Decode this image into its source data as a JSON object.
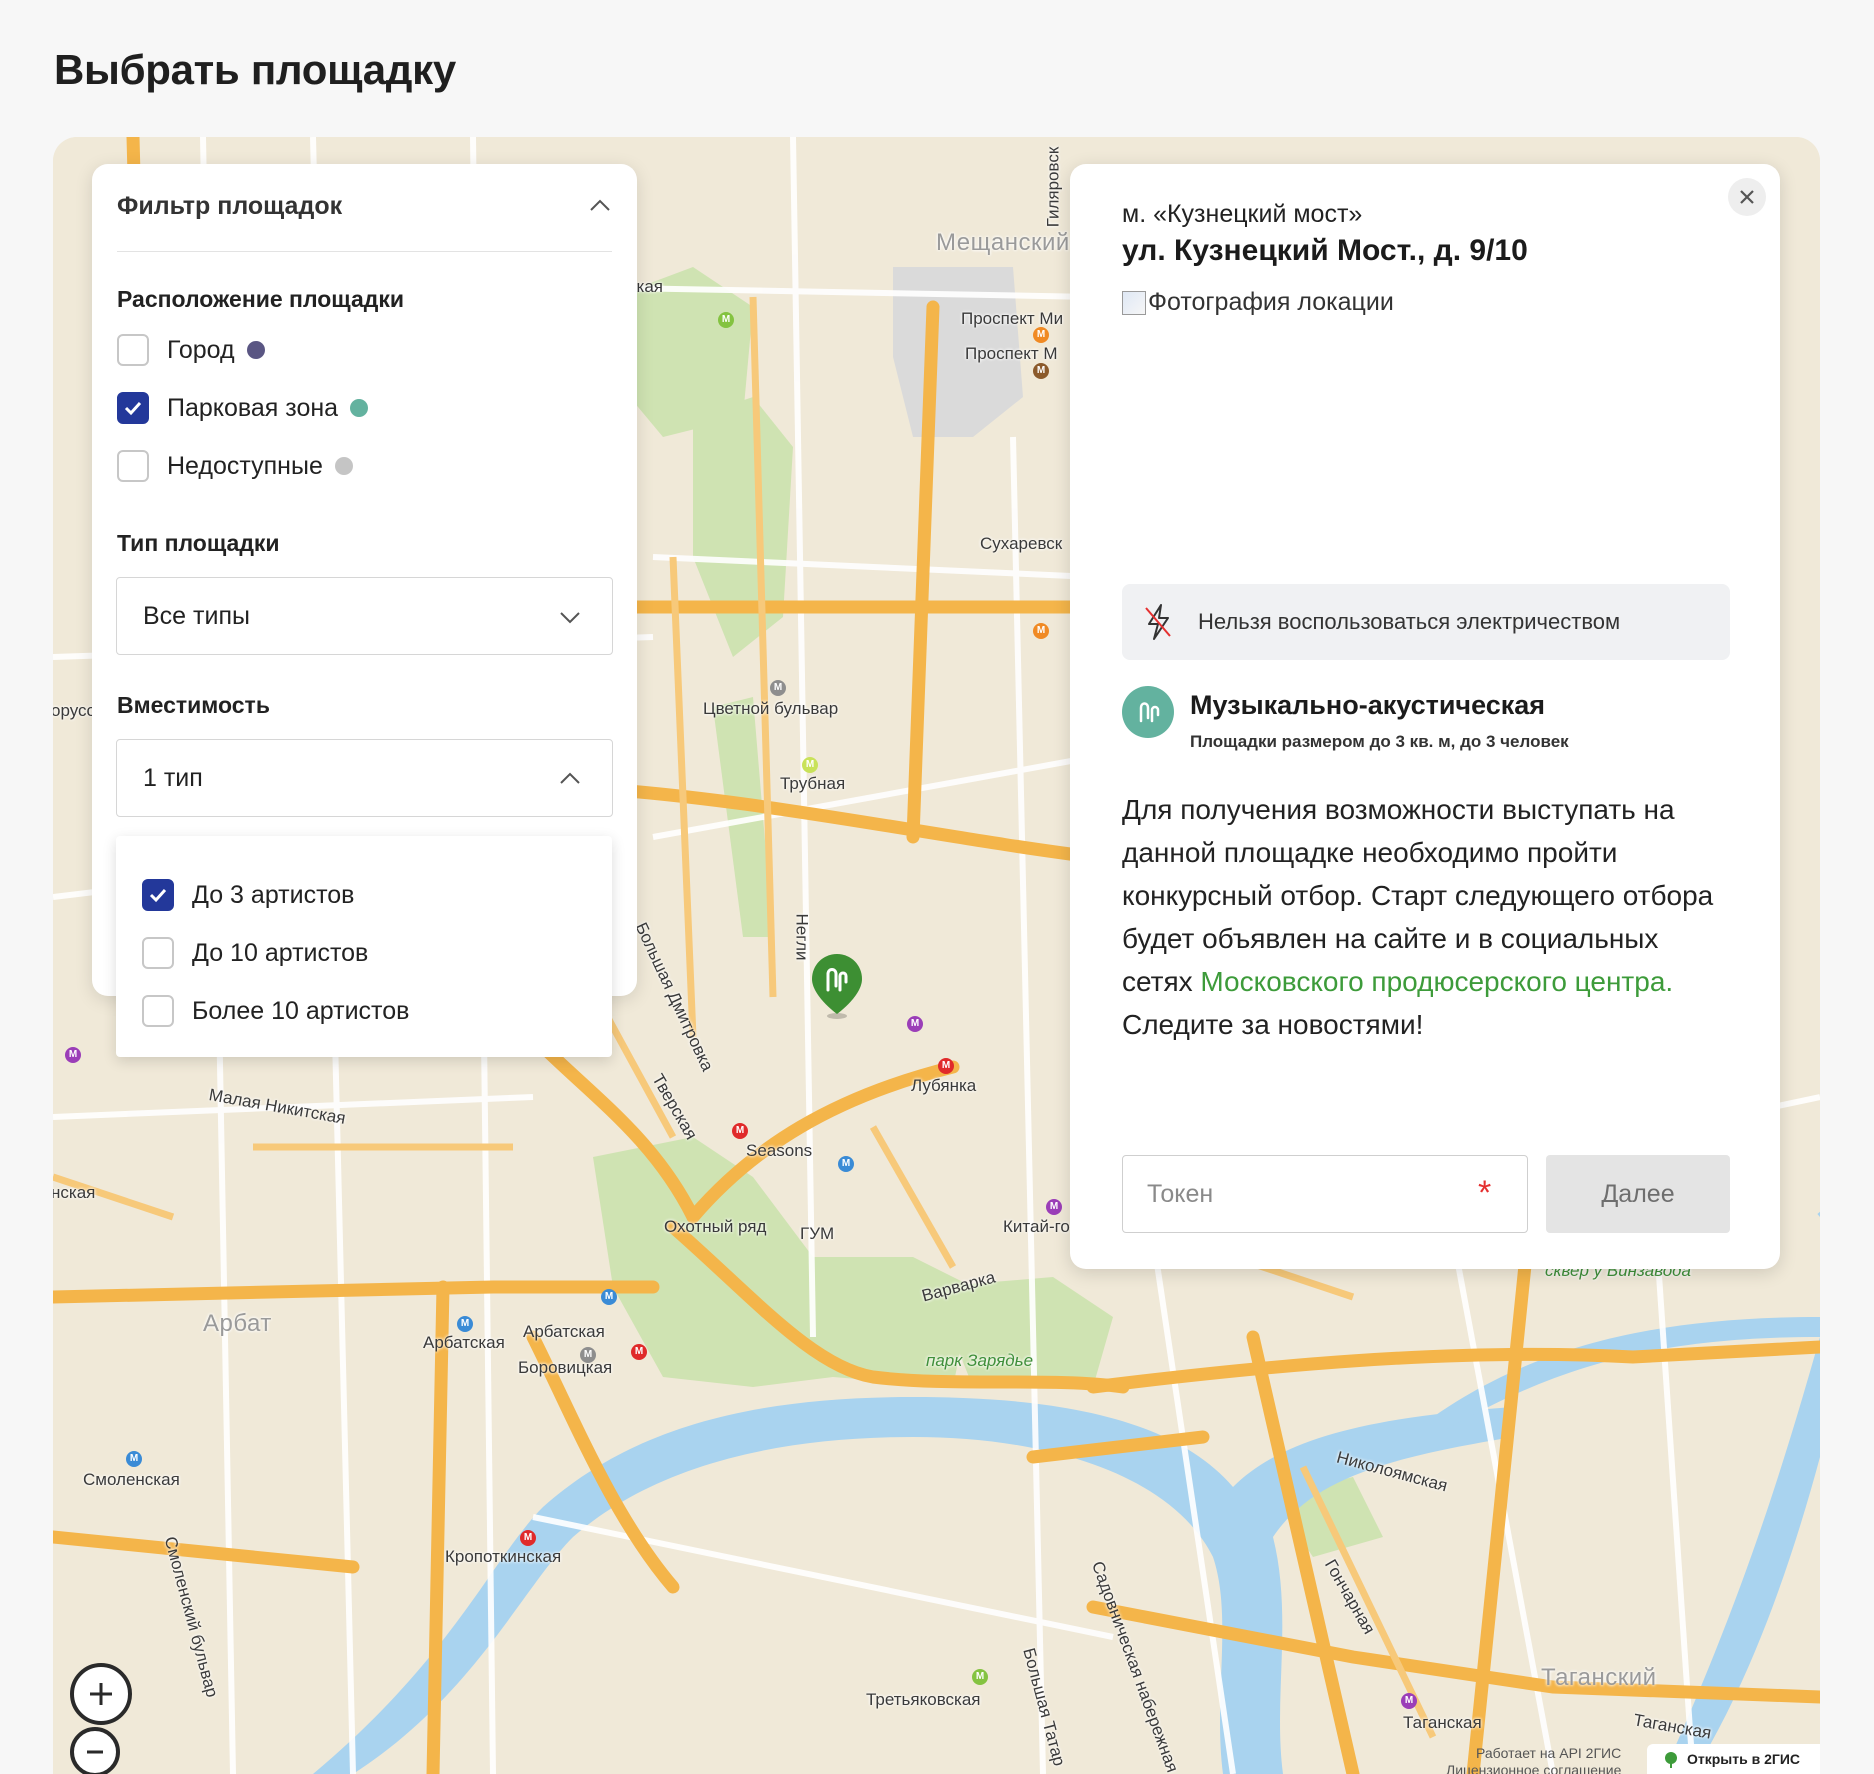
{
  "page": {
    "title": "Выбрать площадку"
  },
  "colors": {
    "accent": "#23389a",
    "link": "#3d9b3a",
    "city_dot": "#5a5683",
    "park_dot": "#63b29f",
    "unavailable_dot": "#c5c5c5",
    "error": "#e53030"
  },
  "filter": {
    "title": "Фильтр площадок",
    "location_section": "Расположение площадки",
    "location_options": [
      {
        "label": "Город",
        "checked": false
      },
      {
        "label": "Парковая зона",
        "checked": true
      },
      {
        "label": "Недоступные",
        "checked": false
      }
    ],
    "type_section": "Тип площадки",
    "type_value": "Все типы",
    "capacity_section": "Вместимость",
    "capacity_value": "1 тип",
    "capacity_options": [
      {
        "label": "До 3 артистов",
        "checked": true
      },
      {
        "label": "До 10 артистов",
        "checked": false
      },
      {
        "label": "Более 10 артистов",
        "checked": false
      }
    ]
  },
  "location": {
    "metro": "м. «Кузнецкий мост»",
    "address": "ул. Кузнецкий Мост., д. 9/10",
    "photo_alt": "Фотография локации",
    "notice": "Нельзя воспользоваться электричеством",
    "type_name": "Музыкально-акустическая",
    "type_desc": "Площадки размером до 3 кв. м, до 3 человек",
    "body_prefix": "Для получения возможности выступать на данной площадке необходимо пройти конкурсный отбор. Старт следующего отбора будет объявлен на сайте и в социальных сетях ",
    "body_link": "Московского продюсерского центра.",
    "body_suffix": " Следите за новостями!",
    "token_placeholder": "Токен",
    "next_label": "Далее"
  },
  "map": {
    "labels": {
      "dostoevskaya": "Достоевская",
      "meshchansky": "Мещанский",
      "prospekt_mira_1": "Проспект Ми",
      "prospekt_mira_2": "Проспект М",
      "sukharevskaya": "Сухаревск",
      "tsvetnoy": "Цветной бульвар",
      "trubnaya": "Трубная",
      "lubyanka": "Лубянка",
      "seasons": "Seasons",
      "okhotny": "Охотный ряд",
      "gum": "ГУМ",
      "kitay_gorod": "Китай-го",
      "varvarka": "Варварка",
      "zaryadye": "парк Зарядье",
      "arbat": "Арбат",
      "arbatskaya_1": "Арбатская",
      "arbatskaya_2": "Арбатская",
      "borovitskaya": "Боровицкая",
      "smolenskaya": "Смоленская",
      "kropotkinskaya": "Кропоткинская",
      "tretyakovskaya": "Третьяковская",
      "taganskaya": "Таганская",
      "taganskaya_2": "Таганская",
      "tagansky": "Таганский",
      "nikoloyamskaya": "Николоямская",
      "goncharnaya": "Гончарная",
      "malaya_nikitskaya": "Малая Никитская",
      "tverskaya": "Тверская",
      "bolshaya_dmitrovka": "Большая Дмитровка",
      "neglinnaya": "Негли",
      "smolensky_bulvar": "Смоленский бульвар",
      "sadovnicheskaya": "Садовническая набережная",
      "bolshaya_tatarskaya": "Большая Татар",
      "skver": "сквер у Винзавода",
      "gilyarovskogo": "Гиляровск",
      "chkalovskaya": "нская",
      "kurskaya_left": "орусс"
    },
    "attribution_api": "Работает на API 2ГИС",
    "attribution_license": "Лицензионное соглашение",
    "open_2gis": "Открыть в 2ГИС"
  }
}
